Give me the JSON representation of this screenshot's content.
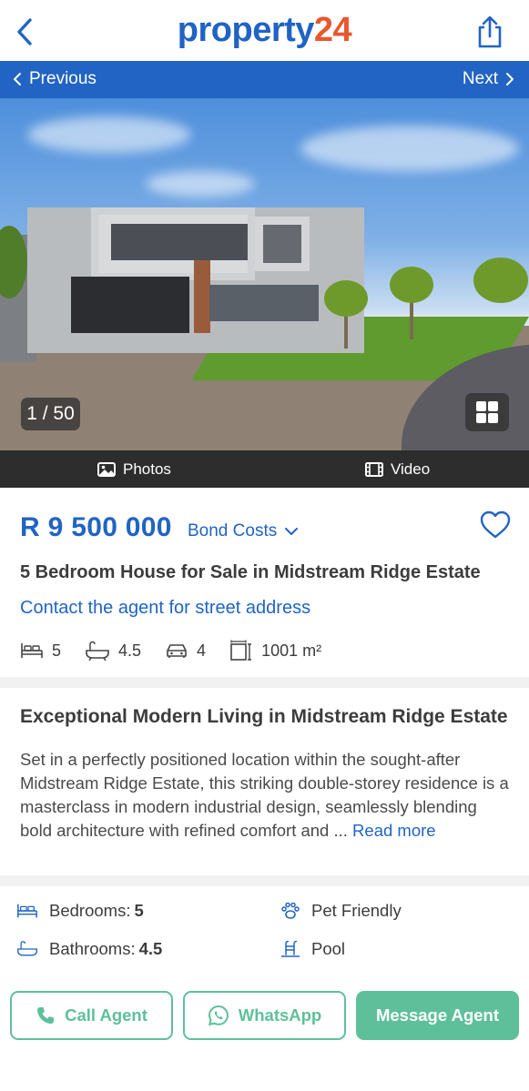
{
  "header": {
    "logo_word": "property",
    "logo_number": "24",
    "back_icon": "chevron-left-icon",
    "share_icon": "share-icon"
  },
  "nav": {
    "previous_label": "Previous",
    "next_label": "Next"
  },
  "gallery": {
    "counter": "1 / 50",
    "grid_icon": "grid-icon"
  },
  "media_tabs": {
    "photos_label": "Photos",
    "video_label": "Video"
  },
  "listing": {
    "price": "R 9 500 000",
    "bond_costs_label": "Bond Costs",
    "title": "5 Bedroom House for Sale in Midstream Ridge Estate",
    "contact_link": "Contact the agent for street address",
    "specs": {
      "bedrooms": "5",
      "bathrooms": "4.5",
      "garages": "4",
      "erf_size": "1001 m²"
    }
  },
  "description": {
    "title": "Exceptional Modern Living in  Midstream Ridge Estate",
    "body": "Set in a perfectly positioned location within the sought-after Midstream Ridge Estate, this striking double-storey residence is a masterclass in modern industrial design, seamlessly blending bold architecture with refined comfort and ...",
    "read_more": "Read more"
  },
  "features": {
    "bedrooms_label": "Bedrooms:",
    "bedrooms_value": "5",
    "bathrooms_label": "Bathrooms:",
    "bathrooms_value": "4.5",
    "pet_friendly": "Pet Friendly",
    "pool": "Pool"
  },
  "actions": {
    "call_label": "Call Agent",
    "whatsapp_label": "WhatsApp",
    "message_label": "Message Agent"
  },
  "colors": {
    "brand_blue": "#2164c3",
    "brand_orange": "#e8582e",
    "action_green": "#5ec09b"
  }
}
